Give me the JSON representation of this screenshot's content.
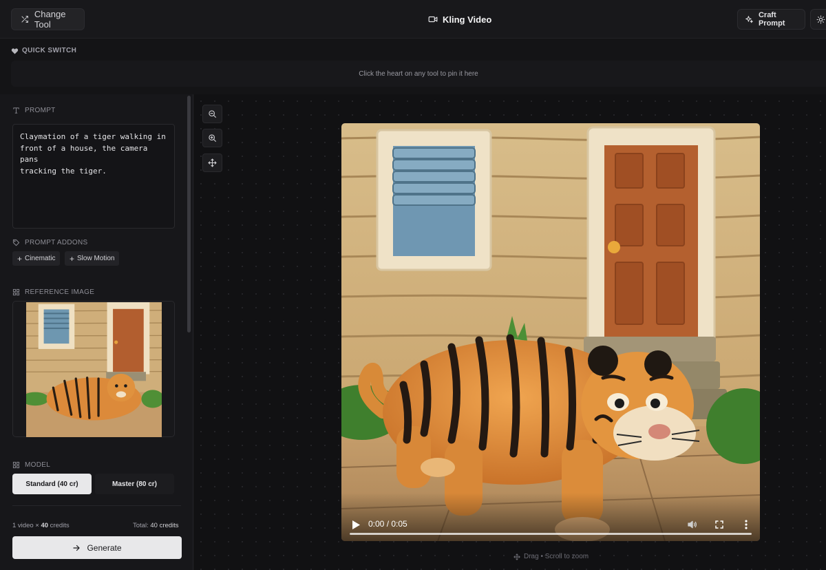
{
  "header": {
    "change_tool_label": "Change Tool",
    "title": "Kling Video",
    "craft_prompt_label": "Craft Prompt"
  },
  "quick_switch": {
    "label": "QUICK SWITCH",
    "empty_hint": "Click the heart on any tool to pin it here"
  },
  "prompt": {
    "label": "PROMPT",
    "value": "Claymation of a tiger walking in\nfront of a house, the camera pans\ntracking the tiger."
  },
  "addons": {
    "label": "PROMPT ADDONS",
    "items": [
      {
        "label": "Cinematic"
      },
      {
        "label": "Slow Motion"
      }
    ]
  },
  "reference": {
    "label": "REFERENCE IMAGE"
  },
  "model": {
    "label": "MODEL",
    "options": [
      {
        "label": "Standard (40 cr)",
        "selected": true
      },
      {
        "label": "Master (80 cr)",
        "selected": false
      }
    ]
  },
  "credits": {
    "per_video_prefix": "1 video × ",
    "per_video_value": "40",
    "per_video_suffix": " credits",
    "total_prefix": "Total: ",
    "total_value": "40 credits"
  },
  "generate_label": "Generate",
  "player": {
    "time": "0:00 / 0:05",
    "progress": 0
  },
  "canvas_hint": "Drag • Scroll to zoom",
  "colors": {
    "background": "#141416",
    "panel": "#17171a",
    "primary_button": "#e8e8ea"
  },
  "icons": [
    "shuffle-icon",
    "video-camera-icon",
    "sparkles-icon",
    "sun-icon",
    "heart-icon",
    "text-icon",
    "tag-icon",
    "grid-icon",
    "plus-icon",
    "arrow-right-icon",
    "zoom-out-icon",
    "zoom-in-icon",
    "move-icon",
    "play-icon",
    "volume-icon",
    "fullscreen-icon",
    "more-vertical-icon"
  ]
}
